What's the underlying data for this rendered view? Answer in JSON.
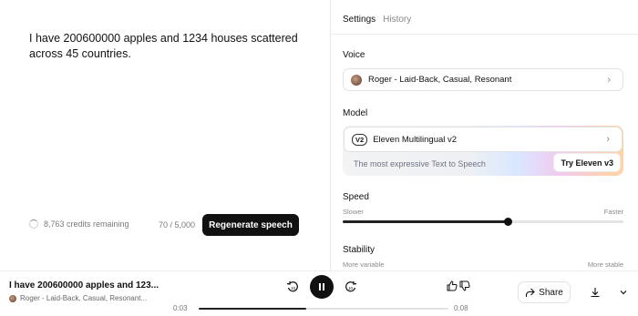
{
  "editor": {
    "text": "I have 200600000 apples and 1234 houses scattered across 45 countries.",
    "credits_remaining": "8,763 credits remaining",
    "char_count": "70 / 5,000",
    "regenerate_label": "Regenerate speech"
  },
  "settings": {
    "tabs": [
      {
        "label": "Settings",
        "active": true
      },
      {
        "label": "History",
        "active": false
      }
    ],
    "voice": {
      "section_label": "Voice",
      "selected": "Roger - Laid-Back, Casual, Resonant"
    },
    "model": {
      "section_label": "Model",
      "badge": "V2",
      "selected": "Eleven Multilingual v2",
      "tagline": "The most expressive Text to Speech",
      "try_label": "Try Eleven v3"
    },
    "speed": {
      "section_label": "Speed",
      "min_label": "Slower",
      "max_label": "Faster",
      "value_fraction": 0.59
    },
    "stability": {
      "section_label": "Stability",
      "min_label": "More variable",
      "max_label": "More stable"
    }
  },
  "player": {
    "title": "I have 200600000 apples and 123...",
    "voice": "Roger - Laid-Back, Casual, Resonant...",
    "current_time": "0:03",
    "duration": "0:08",
    "progress_fraction": 0.43,
    "share_label": "Share"
  },
  "colors": {
    "primary": "#111111",
    "muted_text": "#7a7a7a",
    "border": "#e2e2e2"
  },
  "icons": [
    "spinner-icon",
    "chevron-right-icon",
    "rewind-10-icon",
    "pause-icon",
    "forward-10-icon",
    "thumbs-up-icon",
    "thumbs-down-icon",
    "share-icon",
    "download-icon",
    "chevron-down-icon"
  ]
}
